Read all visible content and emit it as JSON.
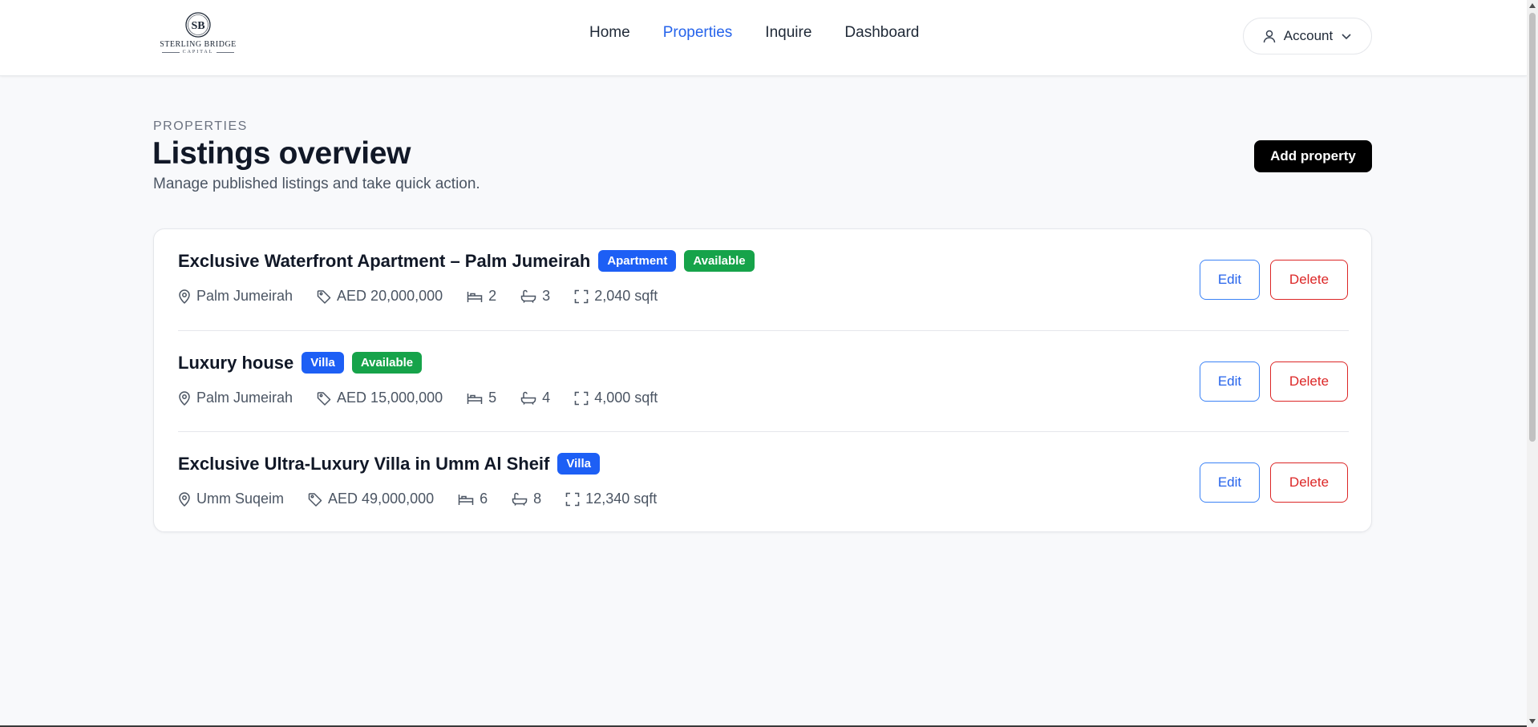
{
  "brand": {
    "name": "STERLING BRIDGE",
    "sub": "CAPITAL",
    "monogram": "SB"
  },
  "nav": {
    "items": [
      {
        "label": "Home"
      },
      {
        "label": "Properties"
      },
      {
        "label": "Inquire"
      },
      {
        "label": "Dashboard"
      }
    ],
    "active": "Properties"
  },
  "account": {
    "label": "Account",
    "icon": "user-icon",
    "chevron": "chevron-down-icon"
  },
  "page": {
    "eyebrow": "PROPERTIES",
    "title": "Listings overview",
    "subtitle": "Manage published listings and take quick action.",
    "add_label": "Add property"
  },
  "listings": [
    {
      "title": "Exclusive Waterfront Apartment – Palm Jumeirah",
      "badges": [
        {
          "label": "Apartment",
          "color": "#1d5ff5"
        },
        {
          "label": "Available",
          "color": "#16a34a"
        }
      ],
      "location": "Palm Jumeirah",
      "price": "AED 20,000,000",
      "beds": "2",
      "baths": "3",
      "area": "2,040 sqft",
      "edit_label": "Edit",
      "delete_label": "Delete"
    },
    {
      "title": "Luxury house",
      "badges": [
        {
          "label": "Villa",
          "color": "#1d5ff5"
        },
        {
          "label": "Available",
          "color": "#16a34a"
        }
      ],
      "location": "Palm Jumeirah",
      "price": "AED 15,000,000",
      "beds": "5",
      "baths": "4",
      "area": "4,000 sqft",
      "edit_label": "Edit",
      "delete_label": "Delete"
    },
    {
      "title": "Exclusive Ultra-Luxury Villa in Umm Al Sheif",
      "badges": [
        {
          "label": "Villa",
          "color": "#1d5ff5"
        }
      ],
      "location": "Umm Suqeim",
      "price": "AED 49,000,000",
      "beds": "6",
      "baths": "8",
      "area": "12,340 sqft",
      "edit_label": "Edit",
      "delete_label": "Delete"
    }
  ],
  "colors": {
    "accent": "#2563eb",
    "danger": "#dc2626",
    "success": "#16a34a",
    "primary_button": "#000000"
  }
}
